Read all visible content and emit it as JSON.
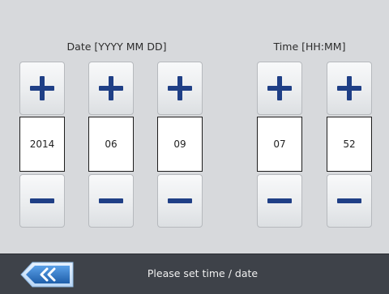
{
  "date_group": {
    "label": "Date [YYYY MM DD]",
    "fields": [
      {
        "name": "year",
        "value": "2014"
      },
      {
        "name": "month",
        "value": "06"
      },
      {
        "name": "day",
        "value": "09"
      }
    ]
  },
  "time_group": {
    "label": "Time [HH:MM]",
    "fields": [
      {
        "name": "hour",
        "value": "07"
      },
      {
        "name": "minute",
        "value": "52"
      }
    ]
  },
  "footer": {
    "status": "Please set time / date",
    "back_icon": "double-chevron-left-icon"
  },
  "colors": {
    "background": "#d7d9dc",
    "icon_blue": "#1f3f86",
    "footer_bg": "#3e4249",
    "back_button_blue": "#2f78c8"
  }
}
